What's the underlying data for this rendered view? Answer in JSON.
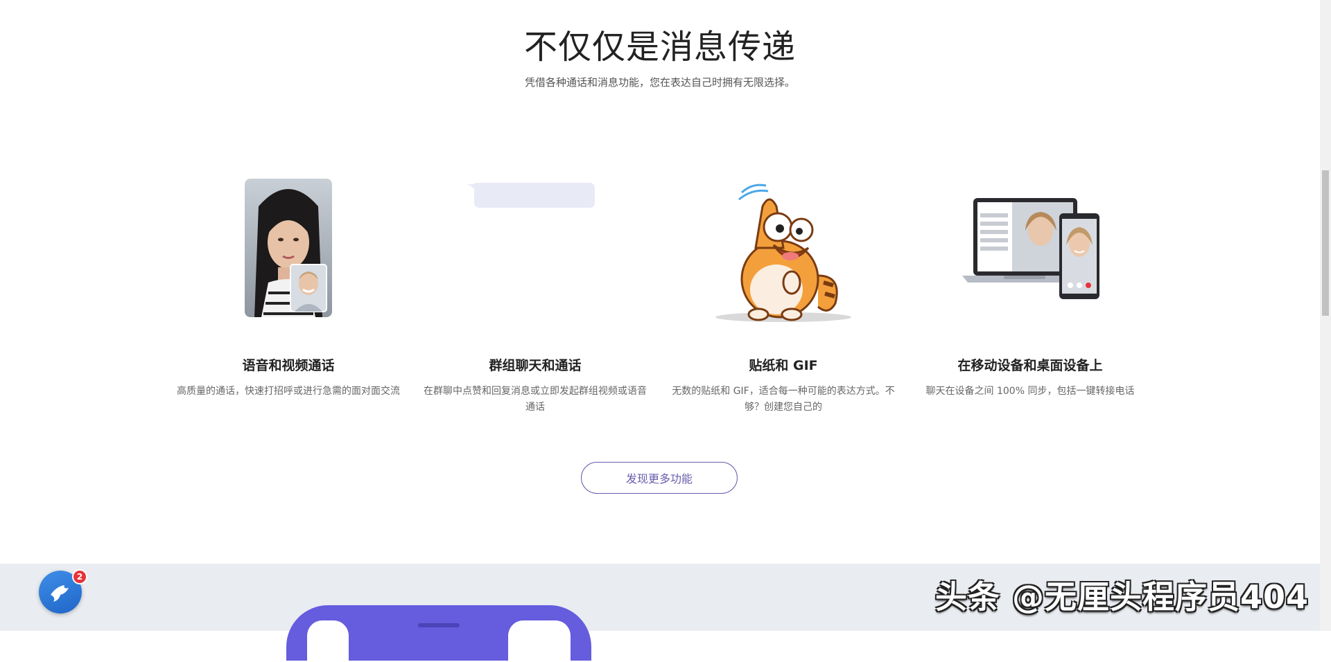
{
  "section": {
    "title": "不仅仅是消息传递",
    "subtitle": "凭借各种通话和消息功能，您在表达自己时拥有无限选择。"
  },
  "features": [
    {
      "title": "语音和视频通话",
      "description": "高质量的通话，快速打招呼或进行急需的面对面交流"
    },
    {
      "title": "群组聊天和通话",
      "description": "在群聊中点赞和回复消息或立即发起群组视频或语音通话"
    },
    {
      "title": "贴纸和 GIF",
      "description": "无数的贴纸和 GIF，适合每一种可能的表达方式。不够？创建您自己的"
    },
    {
      "title": "在移动设备和桌面设备上",
      "description": "聊天在设备之间 100% 同步，包括一键转接电话"
    }
  ],
  "cta": {
    "label": "发现更多功能"
  },
  "floating_app": {
    "badge_count": "2",
    "icon": "viber-bird-icon"
  },
  "watermark": {
    "text": "头条 @无厘头程序员404"
  },
  "colors": {
    "accent": "#665cac",
    "band": "#e9ecf1",
    "phone": "#665cde",
    "badge": "#e8333a"
  }
}
